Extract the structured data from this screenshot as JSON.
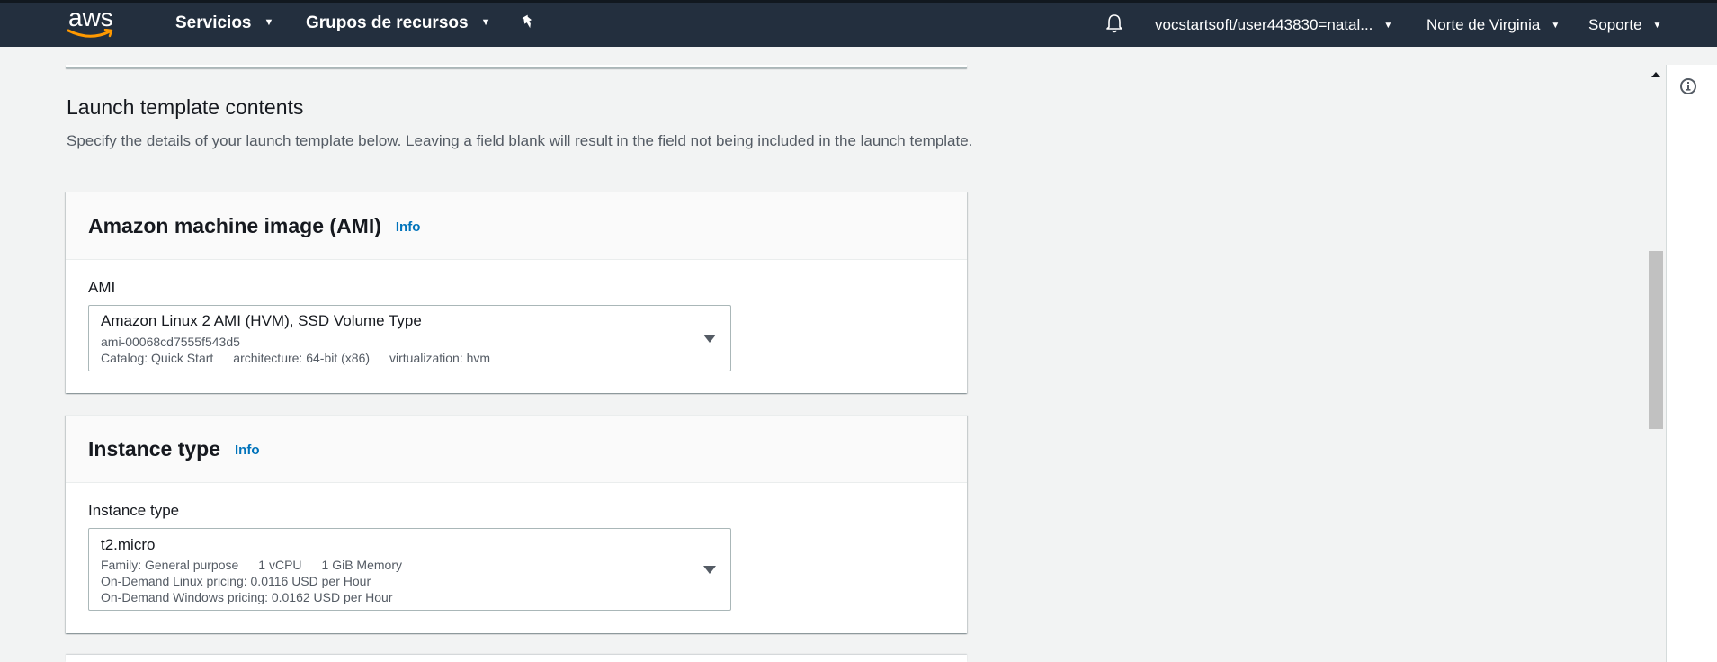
{
  "topnav": {
    "logo_text": "aws",
    "services_label": "Servicios",
    "resource_groups_label": "Grupos de recursos",
    "account_label": "vocstartsoft/user443830=natal...",
    "region_label": "Norte de Virginia",
    "support_label": "Soporte",
    "icons": [
      "pin-icon",
      "bell-icon",
      "chevron-down-icon"
    ]
  },
  "section": {
    "title": "Launch template contents",
    "description": "Specify the details of your launch template below. Leaving a field blank will result in the field not being included in the launch template."
  },
  "ami_card": {
    "title": "Amazon machine image (AMI)",
    "info_link": "Info",
    "field_label": "AMI",
    "selected": {
      "name": "Amazon Linux 2 AMI (HVM), SSD Volume Type",
      "id": "ami-00068cd7555f543d5",
      "catalog": "Catalog: Quick Start",
      "architecture": "architecture: 64-bit (x86)",
      "virtualization": "virtualization: hvm"
    }
  },
  "instance_card": {
    "title": "Instance type",
    "info_link": "Info",
    "field_label": "Instance type",
    "selected": {
      "name": "t2.micro",
      "family": "Family: General purpose",
      "vcpu": "1 vCPU",
      "memory": "1 GiB Memory",
      "linux_pricing": "On-Demand Linux pricing: 0.0116 USD per Hour",
      "windows_pricing": "On-Demand Windows pricing: 0.0162 USD per Hour"
    }
  },
  "colors": {
    "nav_bg": "#232f3e",
    "link": "#0073bb",
    "page_bg": "#f2f3f3"
  }
}
